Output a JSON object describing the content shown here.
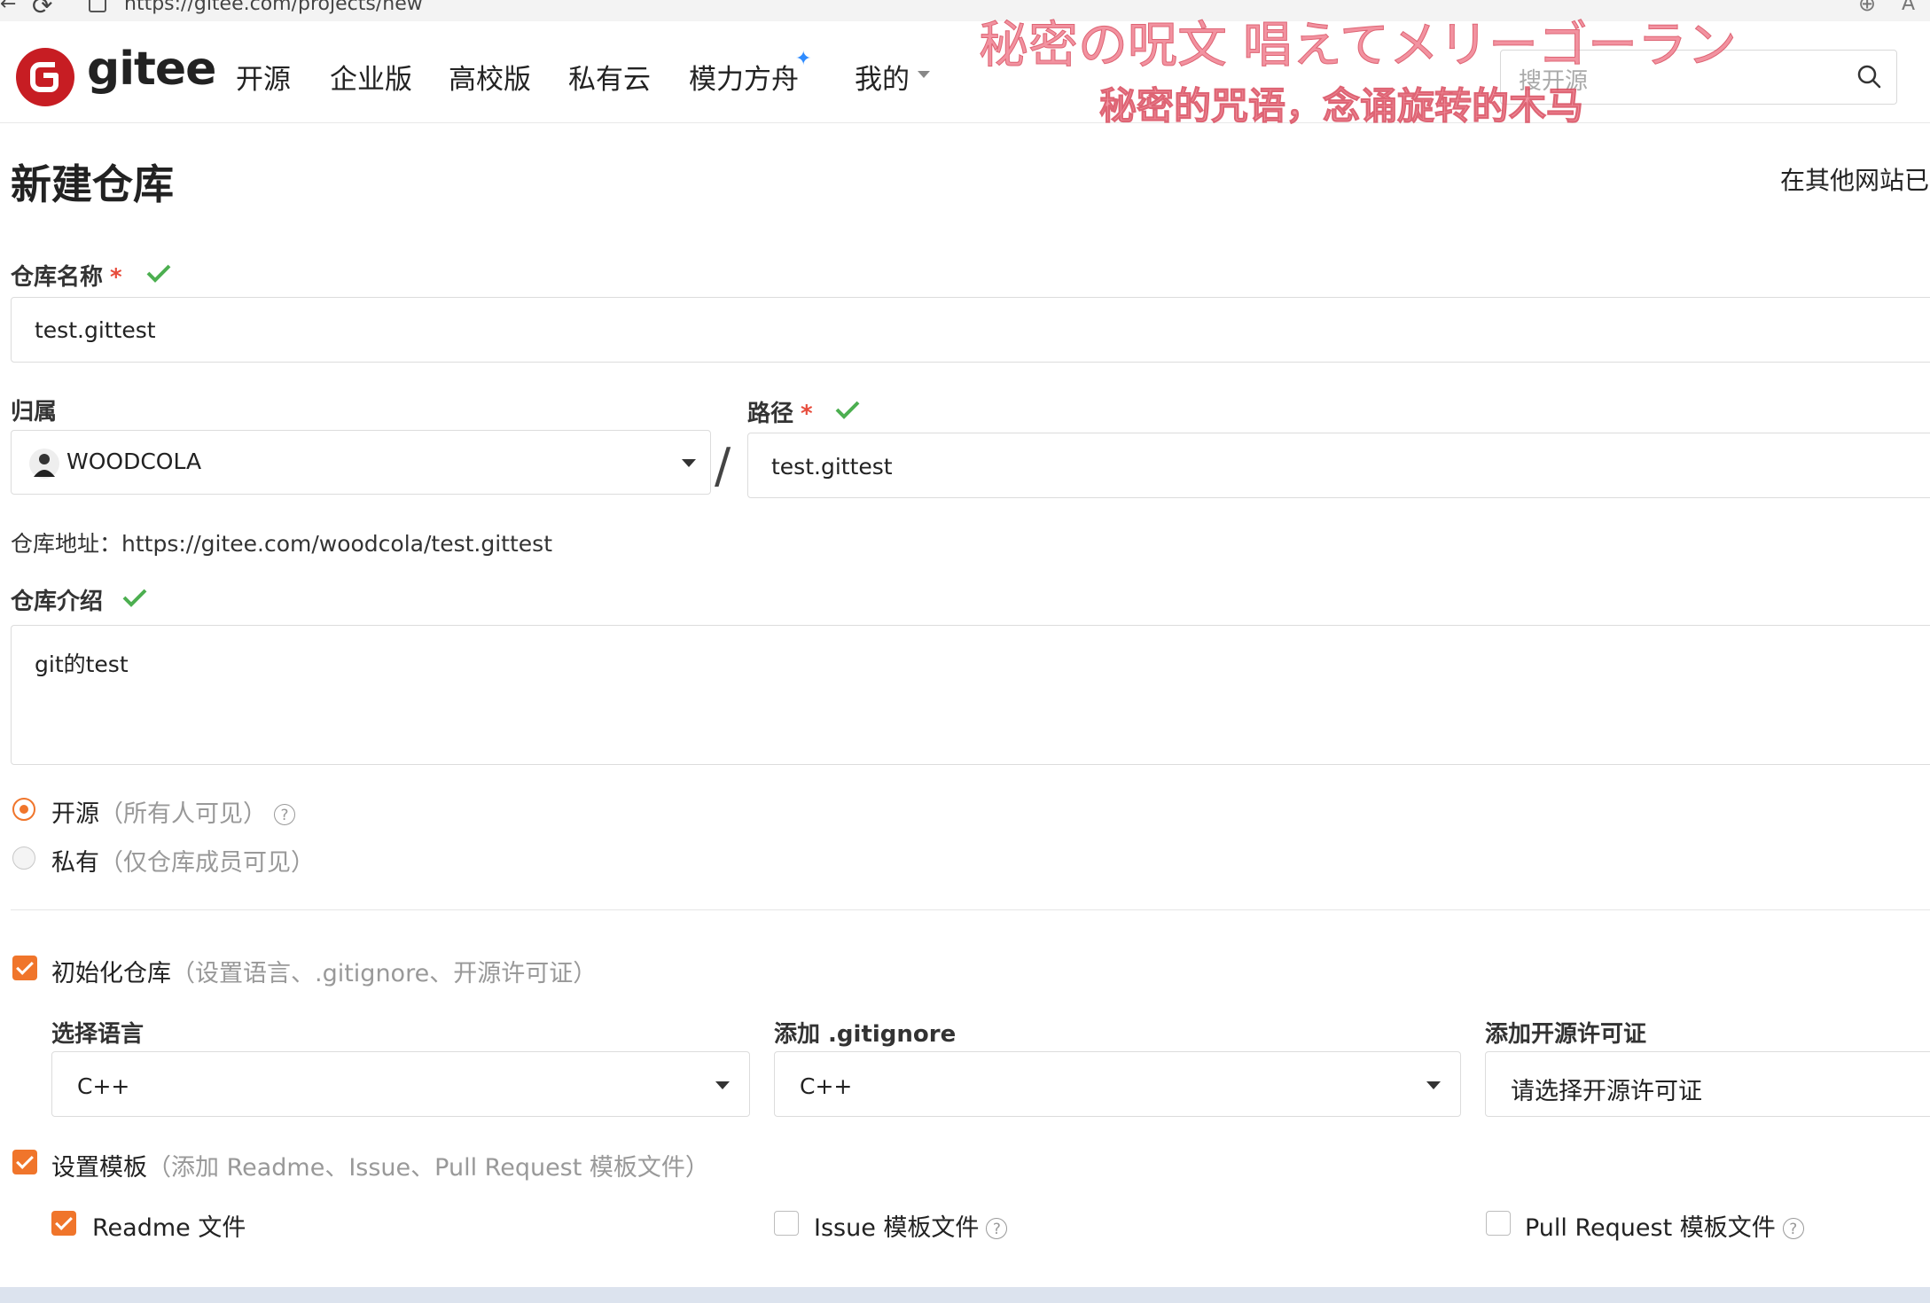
{
  "browser": {
    "url": "https://gitee.com/projects/new",
    "zoom_icon": "zoom-icon",
    "reader_label": "A"
  },
  "header": {
    "logo_text": "gitee",
    "nav": [
      "开源",
      "企业版",
      "高校版",
      "私有云",
      "模力方舟",
      "我的"
    ],
    "search_placeholder": "搜开源"
  },
  "overlay": {
    "line1": "秘密の呪文 唱えてメリーゴーラン",
    "line2": "秘密的咒语，念诵旋转的木马"
  },
  "page": {
    "title": "新建仓库",
    "import_link": "在其他网站已经"
  },
  "form": {
    "name_label": "仓库名称",
    "name_value": "test.gittest",
    "owner_label": "归属",
    "owner_value": "WOODCOLA",
    "path_label": "路径",
    "path_value": "test.gittest",
    "address_prefix": "仓库地址：",
    "address_url": "https://gitee.com/woodcola/test.gittest",
    "desc_label": "仓库介绍",
    "desc_value": "git的test",
    "required_mark": "*"
  },
  "visibility": {
    "public_label": "开源",
    "public_hint": "（所有人可见）",
    "private_label": "私有",
    "private_hint": "（仅仓库成员可见）",
    "selected": "public"
  },
  "init": {
    "label": "初始化仓库",
    "hint": "（设置语言、.gitignore、开源许可证）",
    "checked": true,
    "language_label": "选择语言",
    "language_value": "C++",
    "gitignore_label": "添加 .gitignore",
    "gitignore_value": "C++",
    "license_label": "添加开源许可证",
    "license_placeholder": "请选择开源许可证"
  },
  "template": {
    "label": "设置模板",
    "hint": "（添加 Readme、Issue、Pull Request 模板文件）",
    "checked": true,
    "readme_label": "Readme 文件",
    "readme_checked": true,
    "issue_label": "Issue 模板文件",
    "issue_checked": false,
    "pr_label": "Pull Request 模板文件",
    "pr_checked": false
  },
  "colors": {
    "accent": "#f0752b",
    "brand": "#c71d23",
    "check_green": "#4caf50",
    "overlay_pink": "#f08090"
  }
}
